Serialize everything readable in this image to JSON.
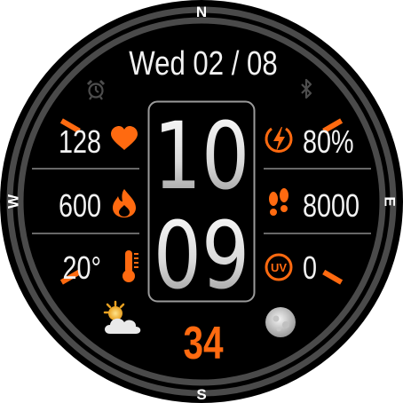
{
  "compass": {
    "north": "N",
    "east": "E",
    "south": "S",
    "west": "W"
  },
  "date": "Wed 02 / 08",
  "time": {
    "hours": "10",
    "minutes": "09"
  },
  "left_stats": [
    {
      "value": "128",
      "icon": "heart-icon"
    },
    {
      "value": "600",
      "icon": "flame-icon"
    },
    {
      "value": "20°",
      "icon": "thermometer-icon"
    }
  ],
  "right_stats": [
    {
      "value": "80%",
      "icon": "battery-charging-icon"
    },
    {
      "value": "8000",
      "icon": "footsteps-icon"
    },
    {
      "value": "0",
      "icon": "uv-icon",
      "badge": "UV"
    }
  ],
  "bottom_number": "34",
  "top_icons": {
    "left": "alarm-clock-icon",
    "right": "bluetooth-icon"
  },
  "bottom_icons": {
    "left": "partly-cloudy-icon",
    "right": "moon-phase-icon"
  },
  "colors": {
    "accent": "#ff6a10",
    "background": "#000000",
    "ring": "#4a4a4a",
    "text": "#f2f2f2"
  }
}
